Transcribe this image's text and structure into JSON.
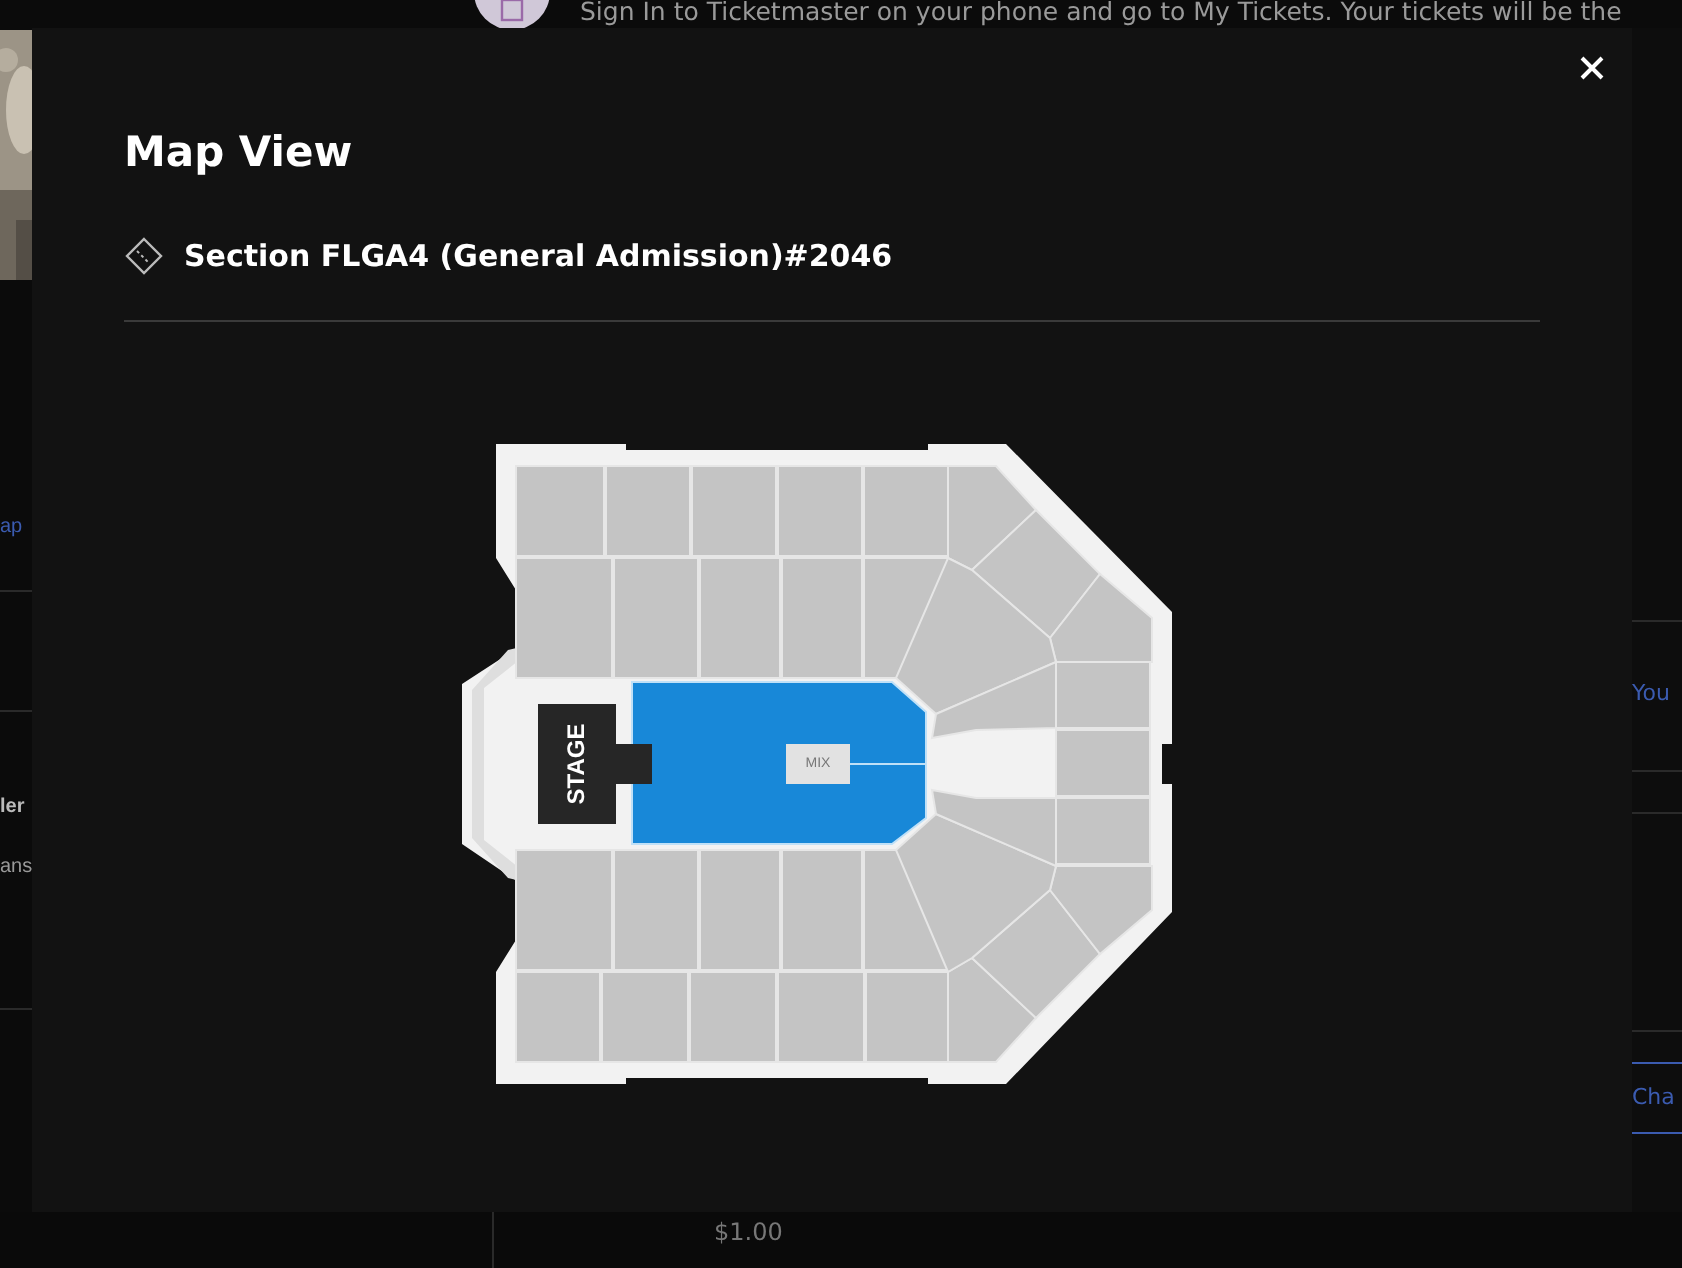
{
  "background_page": {
    "banner_text": "Sign In to Ticketmaster on your phone and go to My Tickets. Your tickets will be the",
    "left_fragments": [
      {
        "text": "ap",
        "kind": "link"
      },
      {
        "text": "ler",
        "kind": "heading"
      },
      {
        "text": "ans",
        "kind": "body"
      }
    ],
    "right_fragments": [
      {
        "text": "You",
        "kind": "link"
      },
      {
        "text": "Cha",
        "kind": "link"
      }
    ],
    "price": "$1.00"
  },
  "modal": {
    "title": "Map View",
    "section": "Section FLGA4 (General Admission)#2046",
    "map": {
      "stage_label": "STAGE",
      "mix_label": "MIX",
      "floor": {
        "selected": true
      }
    }
  }
}
